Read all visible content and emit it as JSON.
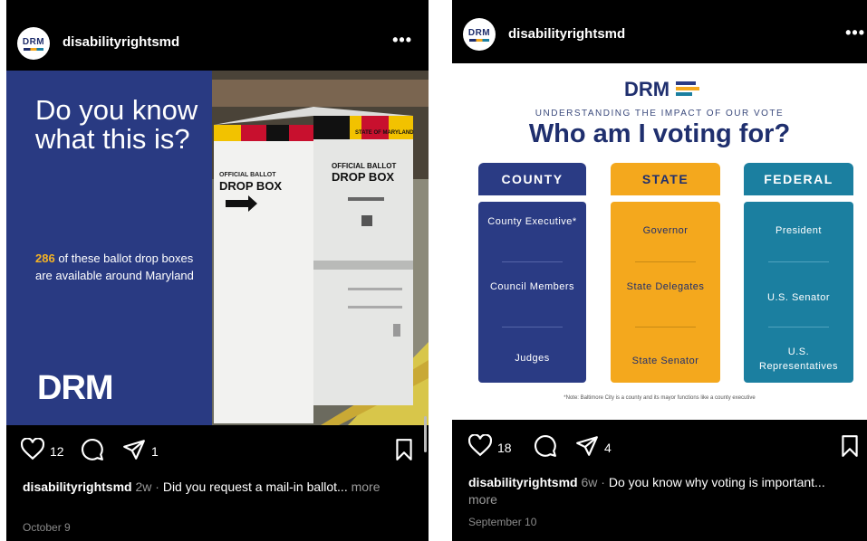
{
  "post1": {
    "username": "disabilityrightsmd",
    "avatar_text": "DRM",
    "image": {
      "headline": "Do you know what this is?",
      "stat_number": "286",
      "stat_text": " of these ballot drop boxes are available around Maryland",
      "logo": "DRM",
      "box_sign_1": "OFFICIAL BALLOT",
      "box_sign_2": "DROP BOX",
      "box_label_state": "STATE OF MARYLAND"
    },
    "likes": "12",
    "shares": "1",
    "caption": {
      "user": "disabilityrightsmd",
      "time": "2w",
      "text": "Did you request a mail-in ballot...",
      "more": "more"
    },
    "date": "October 9"
  },
  "post2": {
    "username": "disabilityrightsmd",
    "avatar_text": "DRM",
    "image": {
      "logo": "DRM",
      "subtitle": "UNDERSTANDING THE IMPACT OF OUR VOTE",
      "title": "Who am I voting for?",
      "columns": [
        {
          "header": "COUNTY",
          "items": [
            "County Executive*",
            "Council Members",
            "Judges"
          ]
        },
        {
          "header": "STATE",
          "items": [
            "Governor",
            "State Delegates",
            "State Senator"
          ]
        },
        {
          "header": "FEDERAL",
          "items": [
            "President",
            "U.S. Senator",
            "U.S. Representatives"
          ]
        }
      ],
      "note": "*Note: Baltimore City is a county and its mayor functions like a county executive"
    },
    "likes": "18",
    "shares": "4",
    "caption": {
      "user": "disabilityrightsmd",
      "time": "6w",
      "text": "Do you know why voting is important...",
      "more": "more"
    },
    "date": "September 10"
  },
  "icons": {
    "like": "heart-icon",
    "comment": "comment-icon",
    "share": "send-icon",
    "save": "bookmark-icon",
    "more": "more-options-icon"
  },
  "colors": {
    "drm_navy": "#293a82",
    "drm_gold": "#f4a81d",
    "drm_teal": "#1b7fa0",
    "stat_highlight": "#f5b324",
    "background": "#000000"
  }
}
